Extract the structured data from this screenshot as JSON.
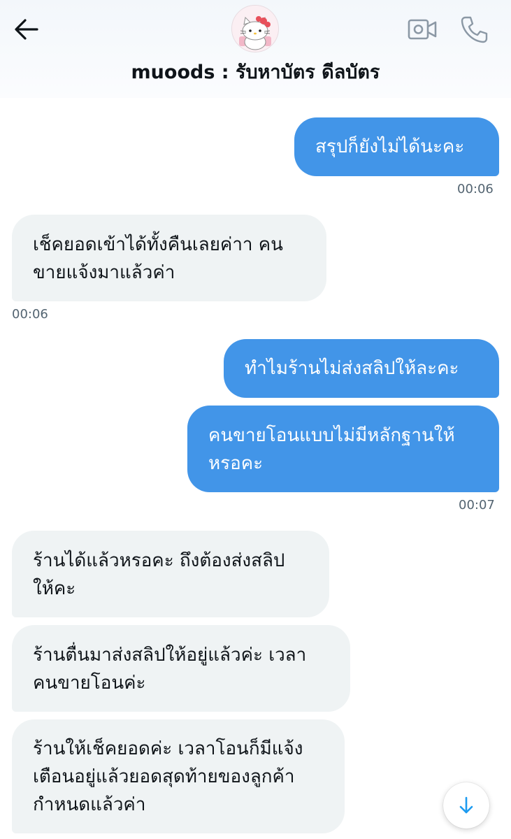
{
  "header": {
    "contact_name": "muoods : รับหาบัตร ดีลบัตร",
    "back_icon": "arrow-left-icon",
    "video_icon": "video-camera-icon",
    "call_icon": "phone-icon",
    "avatar_icon": "hello-kitty-avatar"
  },
  "messages": [
    {
      "direction": "outgoing",
      "lines": [
        "สรุปก็ยังไม่ได้นะคะ"
      ],
      "time": "00:06"
    },
    {
      "direction": "incoming",
      "lines": [
        "เช็คยอดเข้าได้ทั้งคืนเลยค่าา คน",
        "ขายแจ้งมาแล้วค่า"
      ],
      "time": "00:06"
    },
    {
      "direction": "outgoing",
      "lines": [
        "ทำไมร้านไม่ส่งสลิปให้ละคะ"
      ]
    },
    {
      "direction": "outgoing",
      "lines": [
        "คนขายโอนแบบไม่มีหลักฐานให้",
        "หรอคะ"
      ],
      "time": "00:07"
    },
    {
      "direction": "incoming",
      "lines": [
        "ร้านได้แล้วหรอคะ ถึงต้องส่งสลิป",
        "ให้คะ"
      ]
    },
    {
      "direction": "incoming",
      "lines": [
        "ร้านตื่นมาส่งสลิปให้อยู่แล้วค่ะ เวลา",
        "คนขายโอนค่ะ"
      ]
    },
    {
      "direction": "incoming",
      "lines": [
        "ร้านให้เช็คยอดค่ะ เวลาโอนก็มีแจ้ง",
        "เตือนอยู่แล้วยอดสุดท้ายของลูกค้า",
        "กำหนดแล้วค่า"
      ]
    }
  ],
  "scroll_down_icon": "arrow-down-icon",
  "colors": {
    "outgoing_bubble": "#4295e8",
    "incoming_bubble": "#eff3f4",
    "timestamp": "#536471",
    "scroll_arrow": "#1d9bf0"
  }
}
